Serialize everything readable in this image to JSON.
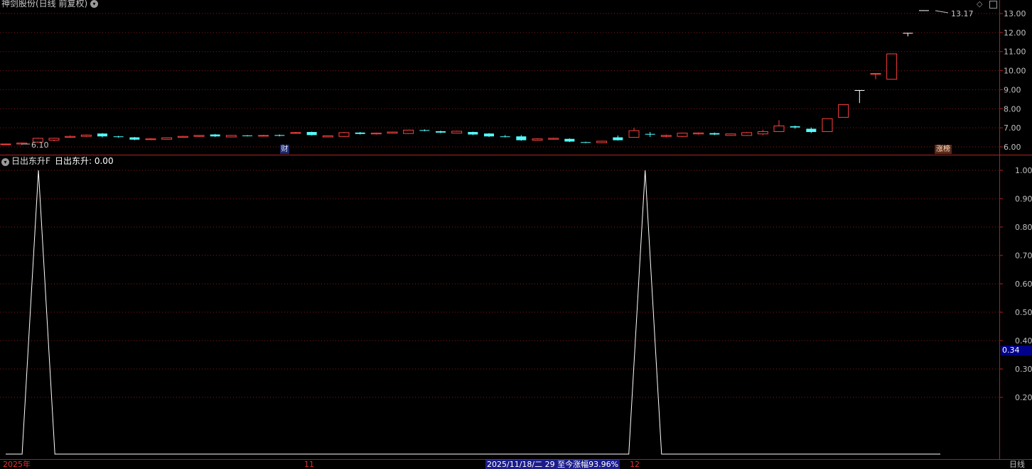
{
  "header": {
    "title": "神剑股份(日线 前复权)",
    "hi_marker": "13.17",
    "lo_marker": "6.10"
  },
  "indicator": {
    "name": "日出东升F",
    "value_label": "日出东升: 0.00",
    "current_axis_value": "0.34"
  },
  "tags": {
    "finance": "财",
    "limit_up": "涨榜"
  },
  "bottom_bar": {
    "year_label": "2025年",
    "month_11": "11",
    "month_12": "12",
    "info": "2025/11/18/二 29 至今涨幅93.96%",
    "period": "日线"
  },
  "colors": {
    "up": "#ff4040",
    "down": "#54ffff",
    "grid": "#8a1a1a",
    "line": "#ffffff"
  },
  "chart_data": [
    {
      "type": "candlestick",
      "y_ticks": [
        "13.00",
        "12.00",
        "11.00",
        "10.00",
        "9.00",
        "8.00",
        "7.00",
        "6.00"
      ],
      "ylim": [
        5.7,
        13.4
      ],
      "candles": [
        {
          "o": 6.12,
          "c": 6.15,
          "h": 6.17,
          "l": 6.1,
          "dir": "up"
        },
        {
          "o": 6.15,
          "c": 6.2,
          "h": 6.22,
          "l": 6.1,
          "dir": "up"
        },
        {
          "o": 6.25,
          "c": 6.45,
          "h": 6.48,
          "l": 6.22,
          "dir": "up"
        },
        {
          "o": 6.35,
          "c": 6.45,
          "h": 6.48,
          "l": 6.3,
          "dir": "up"
        },
        {
          "o": 6.5,
          "c": 6.55,
          "h": 6.6,
          "l": 6.48,
          "dir": "up"
        },
        {
          "o": 6.55,
          "c": 6.62,
          "h": 6.65,
          "l": 6.52,
          "dir": "up"
        },
        {
          "o": 6.7,
          "c": 6.55,
          "h": 6.72,
          "l": 6.5,
          "dir": "down"
        },
        {
          "o": 6.55,
          "c": 6.52,
          "h": 6.58,
          "l": 6.48,
          "dir": "down"
        },
        {
          "o": 6.5,
          "c": 6.38,
          "h": 6.52,
          "l": 6.35,
          "dir": "down"
        },
        {
          "o": 6.38,
          "c": 6.42,
          "h": 6.45,
          "l": 6.36,
          "dir": "up"
        },
        {
          "o": 6.4,
          "c": 6.48,
          "h": 6.5,
          "l": 6.38,
          "dir": "up"
        },
        {
          "o": 6.5,
          "c": 6.55,
          "h": 6.58,
          "l": 6.48,
          "dir": "up"
        },
        {
          "o": 6.55,
          "c": 6.6,
          "h": 6.62,
          "l": 6.52,
          "dir": "up"
        },
        {
          "o": 6.65,
          "c": 6.55,
          "h": 6.68,
          "l": 6.52,
          "dir": "down"
        },
        {
          "o": 6.52,
          "c": 6.6,
          "h": 6.62,
          "l": 6.5,
          "dir": "up"
        },
        {
          "o": 6.6,
          "c": 6.57,
          "h": 6.62,
          "l": 6.55,
          "dir": "down"
        },
        {
          "o": 6.57,
          "c": 6.6,
          "h": 6.63,
          "l": 6.55,
          "dir": "up"
        },
        {
          "o": 6.62,
          "c": 6.58,
          "h": 6.65,
          "l": 6.55,
          "dir": "down"
        },
        {
          "o": 6.72,
          "c": 6.75,
          "h": 6.78,
          "l": 6.7,
          "dir": "up"
        },
        {
          "o": 6.78,
          "c": 6.62,
          "h": 6.8,
          "l": 6.6,
          "dir": "down"
        },
        {
          "o": 6.52,
          "c": 6.58,
          "h": 6.6,
          "l": 6.5,
          "dir": "up"
        },
        {
          "o": 6.55,
          "c": 6.75,
          "h": 6.78,
          "l": 6.52,
          "dir": "up"
        },
        {
          "o": 6.75,
          "c": 6.68,
          "h": 6.78,
          "l": 6.65,
          "dir": "down"
        },
        {
          "o": 6.68,
          "c": 6.72,
          "h": 6.75,
          "l": 6.65,
          "dir": "up"
        },
        {
          "o": 6.72,
          "c": 6.78,
          "h": 6.8,
          "l": 6.7,
          "dir": "up"
        },
        {
          "o": 6.7,
          "c": 6.88,
          "h": 6.9,
          "l": 6.68,
          "dir": "up"
        },
        {
          "o": 6.88,
          "c": 6.85,
          "h": 6.92,
          "l": 6.82,
          "dir": "down"
        },
        {
          "o": 6.82,
          "c": 6.75,
          "h": 6.85,
          "l": 6.72,
          "dir": "down"
        },
        {
          "o": 6.72,
          "c": 6.82,
          "h": 6.85,
          "l": 6.7,
          "dir": "up"
        },
        {
          "o": 6.78,
          "c": 6.65,
          "h": 6.8,
          "l": 6.62,
          "dir": "down"
        },
        {
          "o": 6.7,
          "c": 6.55,
          "h": 6.72,
          "l": 6.52,
          "dir": "down"
        },
        {
          "o": 6.55,
          "c": 6.52,
          "h": 6.62,
          "l": 6.5,
          "dir": "down"
        },
        {
          "o": 6.55,
          "c": 6.35,
          "h": 6.62,
          "l": 6.32,
          "dir": "down"
        },
        {
          "o": 6.35,
          "c": 6.42,
          "h": 6.45,
          "l": 6.33,
          "dir": "up"
        },
        {
          "o": 6.4,
          "c": 6.45,
          "h": 6.48,
          "l": 6.38,
          "dir": "up"
        },
        {
          "o": 6.42,
          "c": 6.28,
          "h": 6.45,
          "l": 6.25,
          "dir": "down"
        },
        {
          "o": 6.25,
          "c": 6.23,
          "h": 6.27,
          "l": 6.2,
          "dir": "down"
        },
        {
          "o": 6.22,
          "c": 6.3,
          "h": 6.32,
          "l": 6.2,
          "dir": "up"
        },
        {
          "o": 6.35,
          "c": 6.5,
          "h": 6.6,
          "l": 6.33,
          "dir": "down"
        },
        {
          "o": 6.5,
          "c": 6.85,
          "h": 7.0,
          "l": 6.48,
          "dir": "up"
        },
        {
          "o": 6.65,
          "c": 6.68,
          "h": 6.78,
          "l": 6.52,
          "dir": "down"
        },
        {
          "o": 6.55,
          "c": 6.6,
          "h": 6.65,
          "l": 6.5,
          "dir": "up"
        },
        {
          "o": 6.55,
          "c": 6.72,
          "h": 6.75,
          "l": 6.52,
          "dir": "up"
        },
        {
          "o": 6.68,
          "c": 6.73,
          "h": 6.76,
          "l": 6.64,
          "dir": "up"
        },
        {
          "o": 6.72,
          "c": 6.65,
          "h": 6.75,
          "l": 6.62,
          "dir": "down"
        },
        {
          "o": 6.6,
          "c": 6.68,
          "h": 6.7,
          "l": 6.58,
          "dir": "up"
        },
        {
          "o": 6.6,
          "c": 6.75,
          "h": 6.78,
          "l": 6.58,
          "dir": "up"
        },
        {
          "o": 6.68,
          "c": 6.8,
          "h": 6.9,
          "l": 6.62,
          "dir": "up"
        },
        {
          "o": 6.8,
          "c": 7.1,
          "h": 7.4,
          "l": 6.78,
          "dir": "up"
        },
        {
          "o": 7.08,
          "c": 7.02,
          "h": 7.12,
          "l": 6.95,
          "dir": "down"
        },
        {
          "o": 6.95,
          "c": 6.78,
          "h": 7.02,
          "l": 6.72,
          "dir": "down"
        },
        {
          "o": 6.8,
          "c": 7.48,
          "h": 7.48,
          "l": 6.78,
          "dir": "up"
        },
        {
          "o": 7.55,
          "c": 8.22,
          "h": 8.22,
          "l": 7.55,
          "dir": "up"
        },
        {
          "o": 8.98,
          "c": 8.98,
          "h": 8.98,
          "l": 8.3,
          "dir": "flat"
        },
        {
          "o": 9.85,
          "c": 9.85,
          "h": 9.85,
          "l": 9.55,
          "dir": "up"
        },
        {
          "o": 9.55,
          "c": 10.88,
          "h": 10.88,
          "l": 9.55,
          "dir": "up"
        },
        {
          "o": 11.98,
          "c": 11.98,
          "h": 11.98,
          "l": 11.8,
          "dir": "flat"
        },
        {
          "o": 13.17,
          "c": 13.17,
          "h": 13.17,
          "l": 13.17,
          "dir": "flat"
        }
      ]
    },
    {
      "type": "line",
      "name": "日出东升",
      "y_ticks": [
        "1.00",
        "0.90",
        "0.80",
        "0.70",
        "0.60",
        "0.50",
        "0.40",
        "0.30",
        "0.20"
      ],
      "ylim": [
        0.0,
        1.0
      ],
      "values": [
        0,
        0,
        1,
        0,
        0,
        0,
        0,
        0,
        0,
        0,
        0,
        0,
        0,
        0,
        0,
        0,
        0,
        0,
        0,
        0,
        0,
        0,
        0,
        0,
        0,
        0,
        0,
        0,
        0,
        0,
        0,
        0,
        0,
        0,
        0,
        0,
        0,
        0,
        0,
        1,
        0,
        0,
        0,
        0,
        0,
        0,
        0,
        0,
        0,
        0,
        0,
        0,
        0,
        0,
        0,
        0,
        0,
        0
      ]
    }
  ]
}
